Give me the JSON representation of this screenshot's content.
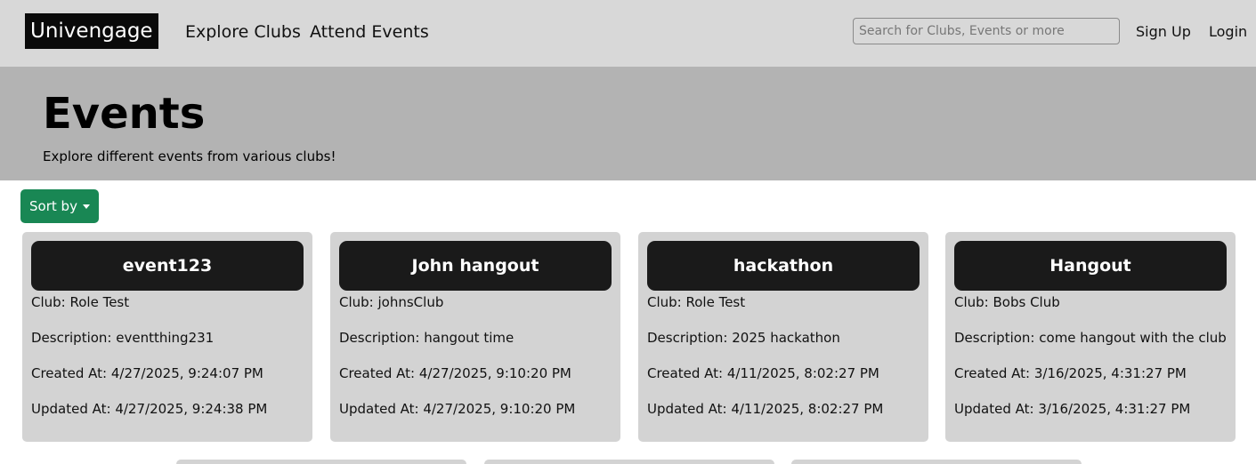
{
  "navbar": {
    "brand": "Univengage",
    "links": [
      "Explore Clubs",
      "Attend Events"
    ],
    "search_placeholder": "Search for Clubs, Events or more",
    "signup": "Sign Up",
    "login": "Login"
  },
  "hero": {
    "title": "Events",
    "subtitle": "Explore different events from various clubs!"
  },
  "sort": {
    "label": "Sort by"
  },
  "labels": {
    "club": "Club: ",
    "description": "Description: ",
    "created": "Created At: ",
    "updated": "Updated At: "
  },
  "events": [
    {
      "title": "event123",
      "club": "Role Test",
      "description": "eventthing231",
      "created": "4/27/2025, 9:24:07 PM",
      "updated": "4/27/2025, 9:24:38 PM"
    },
    {
      "title": "John hangout",
      "club": "johnsClub",
      "description": "hangout time",
      "created": "4/27/2025, 9:10:20 PM",
      "updated": "4/27/2025, 9:10:20 PM"
    },
    {
      "title": "hackathon",
      "club": "Role Test",
      "description": "2025 hackathon",
      "created": "4/11/2025, 8:02:27 PM",
      "updated": "4/11/2025, 8:02:27 PM"
    },
    {
      "title": "Hangout",
      "club": "Bobs Club",
      "description": "come hangout with the club",
      "created": "3/16/2025, 4:31:27 PM",
      "updated": "3/16/2025, 4:31:27 PM"
    }
  ]
}
